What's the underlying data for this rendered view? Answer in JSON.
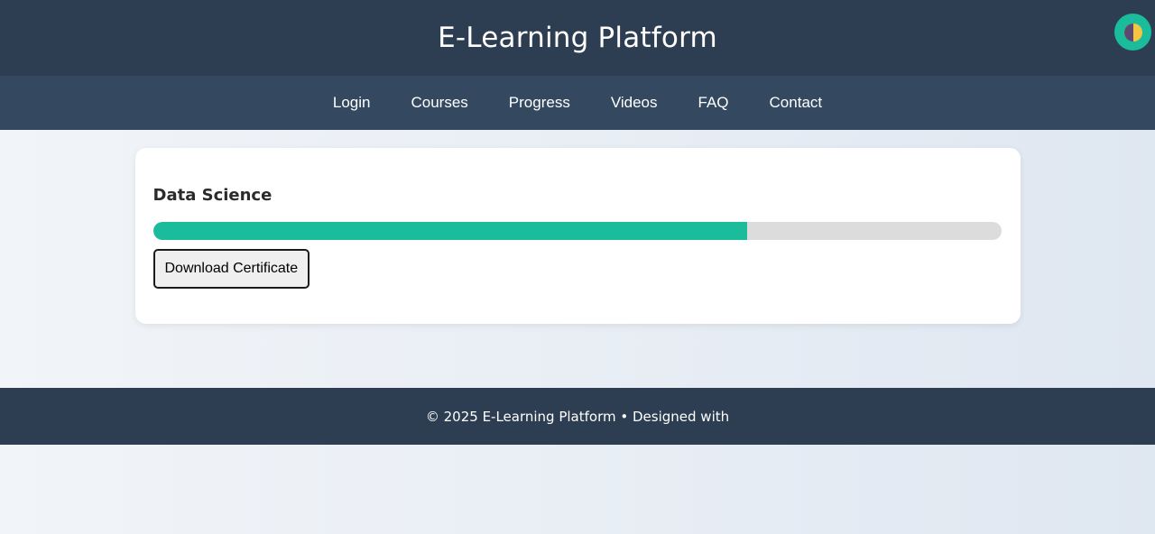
{
  "header": {
    "title": "E-Learning Platform",
    "theme_toggle_icon": "half-moon-theme-icon",
    "accent_color": "#1abc9c",
    "background_color": "#2e3e52"
  },
  "nav": {
    "items": [
      {
        "label": "Login"
      },
      {
        "label": "Courses"
      },
      {
        "label": "Progress"
      },
      {
        "label": "Videos"
      },
      {
        "label": "FAQ"
      },
      {
        "label": "Contact"
      }
    ],
    "background_color": "#344960"
  },
  "course": {
    "title": "Data Science",
    "progress_fraction": 0.7,
    "progress_color": "#1abc9c",
    "download_button_label": "Download Certificate"
  },
  "footer": {
    "text": "© 2025 E-Learning Platform • Designed with"
  }
}
